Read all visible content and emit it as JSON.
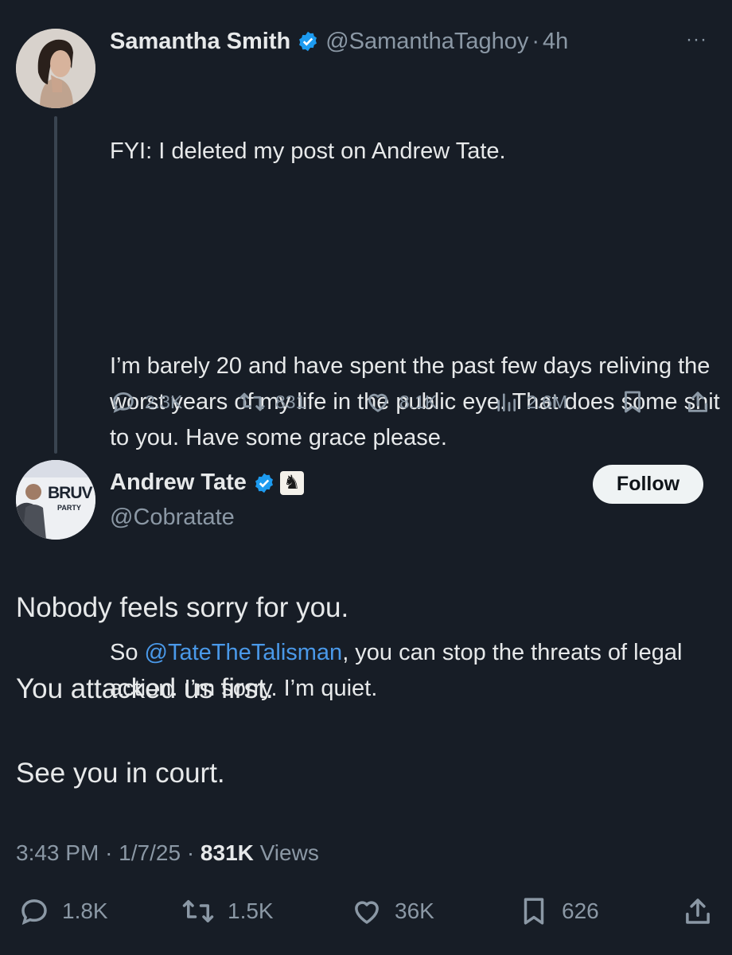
{
  "parent_tweet": {
    "author_name": "Samantha Smith",
    "handle": "@SamanthaTaghoy",
    "separator": "·",
    "time": "4h",
    "more": "···",
    "line1": "FYI: I deleted my post on Andrew Tate.",
    "paragraph2": "I’m barely 20 and have spent the past few days reliving the worst years of my life in the public eye. That does some shit to you. Have some grace please.",
    "p3_prefix": "So ",
    "p3_mention": "@TateTheTalisman",
    "p3_suffix": ", you can stop the threats of legal action. I’m sorry. I’m quiet.",
    "replies": "2.3K",
    "reposts": "831",
    "likes": "8.1K",
    "views": "2.6M"
  },
  "main_tweet": {
    "author_name": "Andrew Tate",
    "handle": "@Cobratate",
    "follow_label": "Follow",
    "avatar_text": "BRUV",
    "avatar_subtext": "PARTY",
    "line1": "Nobody feels sorry for you.",
    "line2": "You attacked us first.",
    "line3": "See you in court.",
    "time": "3:43 PM",
    "date": "1/7/25",
    "views_count": "831K",
    "views_label": "Views",
    "sep": "·",
    "replies": "1.8K",
    "reposts": "1.5K",
    "likes": "36K",
    "bookmarks": "626"
  },
  "colors": {
    "background": "#171d26",
    "text": "#e7e9ea",
    "muted": "#8b98a5",
    "link": "#4a99e9",
    "verified": "#1d9bf0"
  }
}
